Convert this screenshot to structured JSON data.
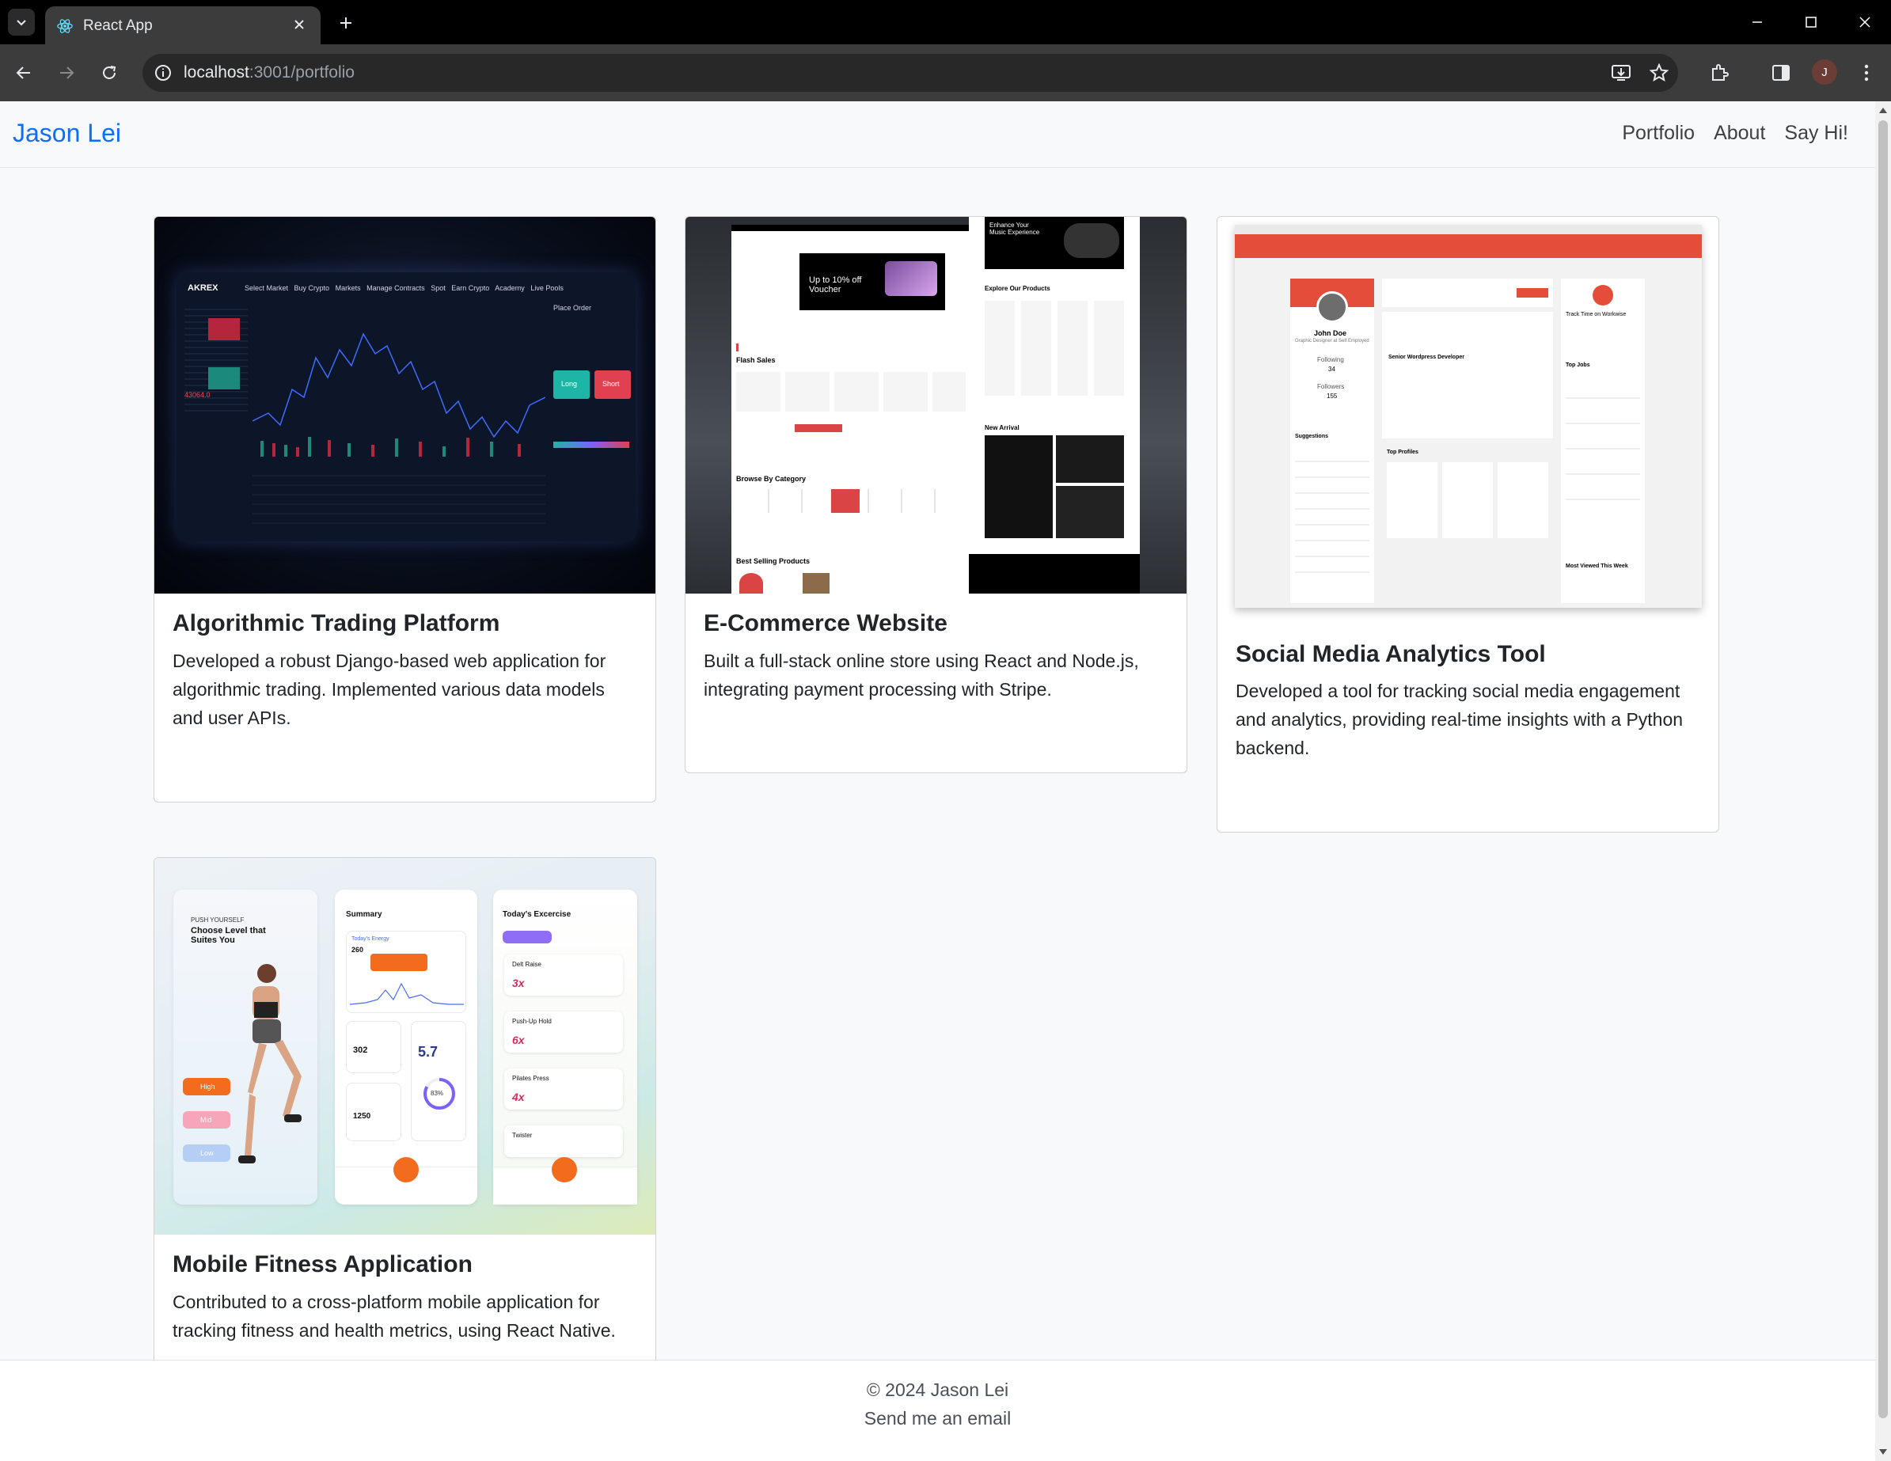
{
  "browser": {
    "tab_title": "React App",
    "url_host": "localhost",
    "url_path": ":3001/portfolio",
    "profile_initial": "J"
  },
  "site": {
    "brand": "Jason Lei",
    "nav": [
      "Portfolio",
      "About",
      "Say Hi!"
    ]
  },
  "projects": [
    {
      "title": "Algorithmic Trading Platform",
      "description": "Developed a robust Django-based web application for algorithmic trading. Implemented various data models and user APIs.",
      "image_text": {
        "logo": "AKREX",
        "menu": [
          "Select Market",
          "Buy Crypto",
          "Markets",
          "Manage Contracts",
          "Spot",
          "Earn Crypto",
          "Academy",
          "Live Pools"
        ],
        "panel": "Place Order",
        "long": "Long",
        "short": "Short",
        "price": "43064.0"
      }
    },
    {
      "title": "E-Commerce Website",
      "description": "Built a full-stack online store using React and Node.js, integrating payment processing with Stripe.",
      "image_text": {
        "voucher": "Up to 10% off Voucher",
        "flash": "Flash Sales",
        "category": "Browse By Category",
        "best": "Best Selling Products",
        "explore": "Explore Our Products",
        "arrival": "New Arrival",
        "music": "Enhance Your Music Experience"
      }
    },
    {
      "title": "Social Media Analytics Tool",
      "description": "Developed a tool for tracking social media engagement and analytics, providing real-time insights with a Python backend.",
      "image_text": {
        "name": "John Doe",
        "role": "Graphic Designer at Self Employed",
        "following": "Following",
        "following_n": "34",
        "followers": "Followers",
        "followers_n": "155",
        "suggestions": "Suggestions",
        "top_profiles": "Top Profiles",
        "track": "Track Time on Workwise",
        "top_jobs": "Top Jobs",
        "most_viewed": "Most Viewed This Week",
        "job": "Senior Wordpress Developer"
      }
    },
    {
      "title": "Mobile Fitness Application",
      "description": "Contributed to a cross-platform mobile application for tracking fitness and health metrics, using React Native.",
      "image_text": {
        "push": "PUSH YOURSELF",
        "headline": "Choose Level that Suites You",
        "summary": "Summary",
        "energy": "Today's Energy",
        "kcal": "260",
        "burnt": "302",
        "walking": "5.7",
        "eaten": "1250",
        "percent": "83%",
        "exercise_title": "Today's Excercise",
        "exercises": [
          "Delt Raise",
          "Push-Up Hold",
          "Pilates Press",
          "Twister"
        ],
        "reps": [
          "3x",
          "6x",
          "4x"
        ],
        "levels": [
          "High",
          "Mid",
          "Low"
        ]
      }
    }
  ],
  "footer": {
    "copyright": "© 2024 Jason Lei",
    "email": "Send me an email"
  },
  "colors": {
    "brand": "#0d6efd",
    "tabbar": "#000000",
    "toolbar": "#3c3c3c"
  }
}
